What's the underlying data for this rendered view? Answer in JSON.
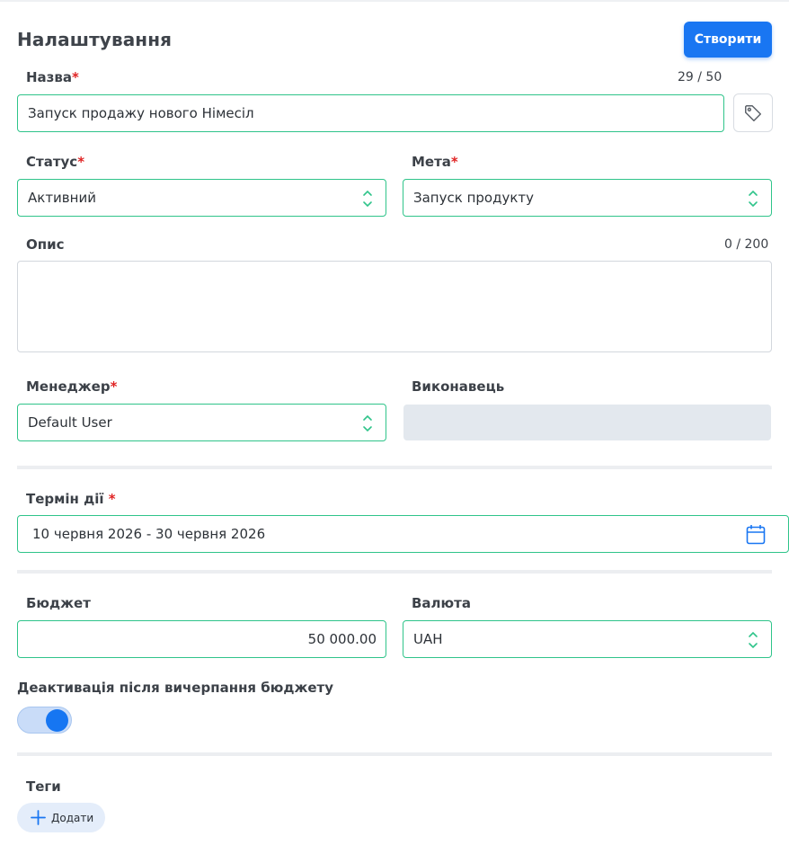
{
  "header": {
    "title": "Налаштування",
    "create_label": "Створити"
  },
  "name_field": {
    "label": "Назва",
    "required_mark": "*",
    "counter": "29 / 50",
    "value": "Запуск продажу нового Німесіл"
  },
  "status_field": {
    "label": "Статус",
    "required_mark": "*",
    "value": "Активний"
  },
  "goal_field": {
    "label": "Мета",
    "required_mark": "*",
    "value": "Запуск продукту"
  },
  "description_field": {
    "label": "Опис",
    "counter": "0 / 200",
    "value": ""
  },
  "manager_field": {
    "label": "Менеджер",
    "required_mark": "*",
    "value": "Default User"
  },
  "executor_field": {
    "label": "Виконавець",
    "value": ""
  },
  "term_field": {
    "label": "Термін дії",
    "required_mark": "*",
    "value": "10 червня 2026 - 30 червня 2026"
  },
  "budget_field": {
    "label": "Бюджет",
    "value": "50 000.00"
  },
  "currency_field": {
    "label": "Валюта",
    "value": "UAH"
  },
  "deactivation": {
    "label": "Деактивація після вичерпання бюджету",
    "enabled": true
  },
  "tags": {
    "label": "Теги",
    "add_label": "Додати"
  },
  "icons": {
    "tag": "tag-icon",
    "calendar": "calendar-icon",
    "select": "chevron-up-down-icon",
    "plus": "plus-icon"
  },
  "colors": {
    "accent": "#1976f2",
    "field_border": "#2fc48a",
    "required": "#e02424",
    "disabled_bg": "#e3e8ee"
  }
}
